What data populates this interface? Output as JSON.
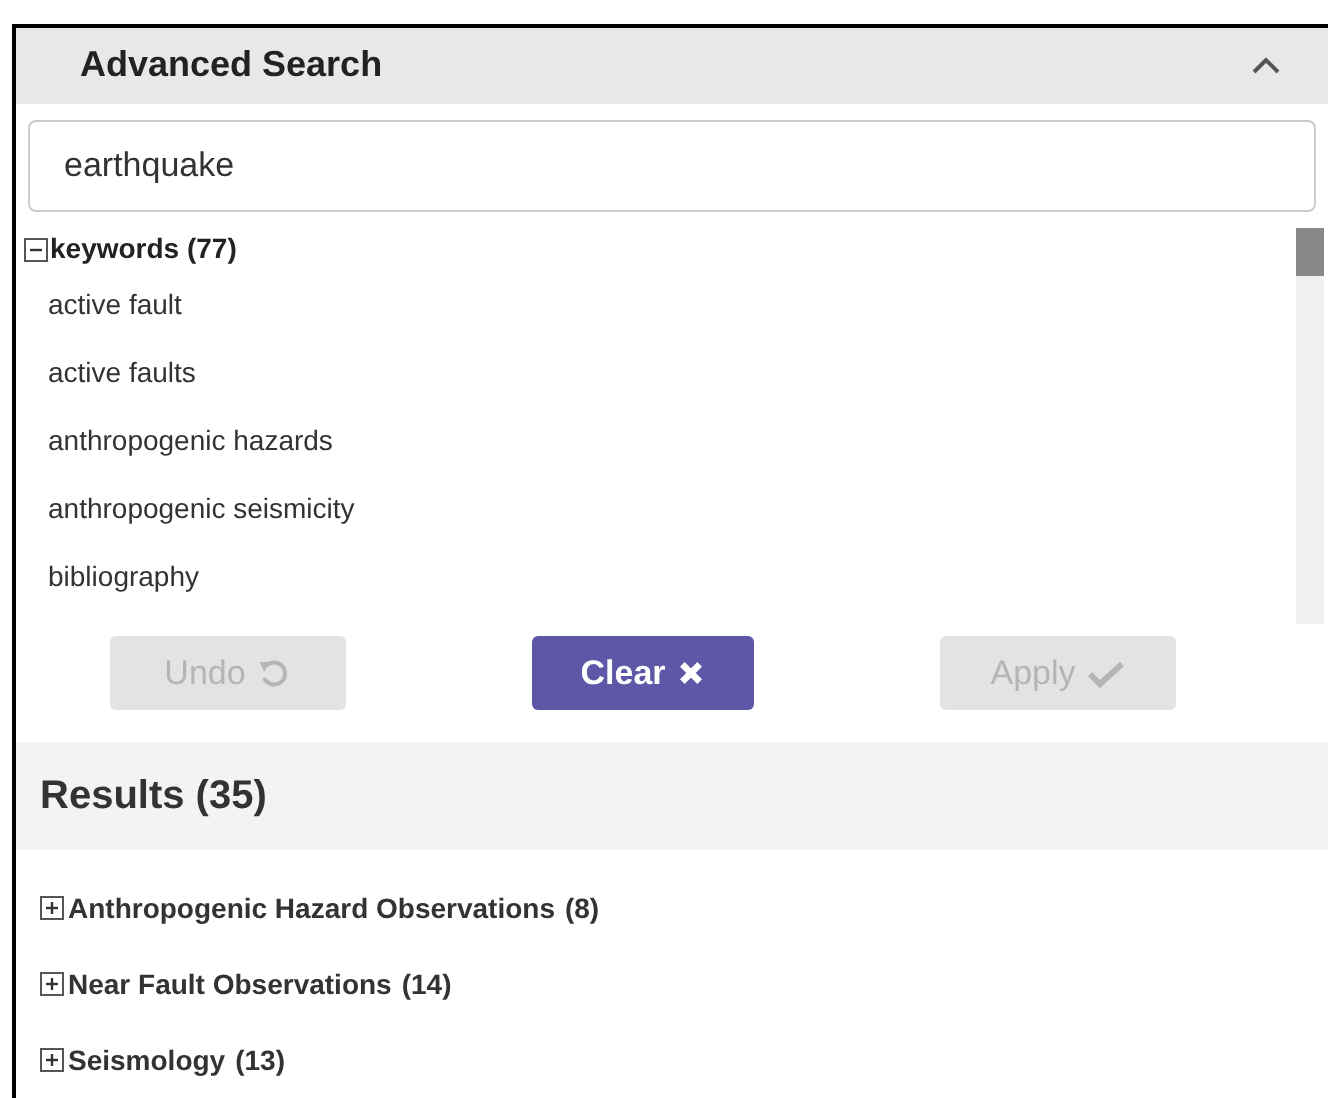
{
  "panel": {
    "title": "Advanced Search",
    "expanded": true
  },
  "search": {
    "value": "earthquake"
  },
  "facet": {
    "label": "keywords (77)",
    "expanded": true,
    "items": [
      "active fault",
      "active faults",
      "anthropogenic hazards",
      "anthropogenic seismicity",
      "bibliography"
    ]
  },
  "buttons": [
    {
      "label": "Undo",
      "kind": "undo",
      "disabled": true
    },
    {
      "label": "Clear",
      "kind": "clear",
      "disabled": false
    },
    {
      "label": "Apply",
      "kind": "apply",
      "disabled": true
    }
  ],
  "results": {
    "title": "Results (35)",
    "groups": [
      {
        "name": "Anthropogenic Hazard Observations",
        "count": "(8)",
        "expanded": false
      },
      {
        "name": "Near Fault Observations",
        "count": "(14)",
        "expanded": false
      },
      {
        "name": "Seismology",
        "count": "(13)",
        "expanded": false
      }
    ]
  }
}
